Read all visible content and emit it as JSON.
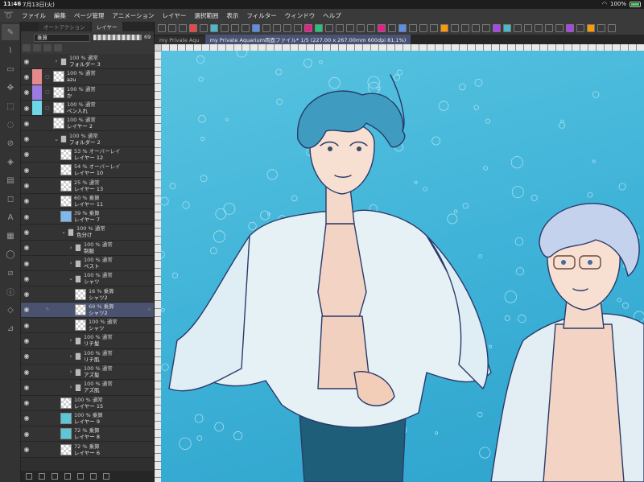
{
  "status": {
    "time": "11:46",
    "date": "7月13日(火)",
    "battery": "100%"
  },
  "menu": [
    "ファイル",
    "編集",
    "ページ管理",
    "アニメーション",
    "レイヤー",
    "選択範囲",
    "表示",
    "フィルター",
    "ウィンドウ",
    "ヘルプ"
  ],
  "panel": {
    "tabs": [
      "オートアクション",
      "レイヤー"
    ],
    "blend_mode": "乗算",
    "opacity": "69"
  },
  "layers": [
    {
      "vis": true,
      "indent": 0,
      "folder": true,
      "arrow": "›",
      "opacity": "100 % 通常",
      "name": "フォルダー 3"
    },
    {
      "vis": true,
      "indent": 0,
      "color": "#e58a8a",
      "opacity": "100 % 通常",
      "name": "azu"
    },
    {
      "vis": true,
      "indent": 0,
      "color": "#9b7be0",
      "opacity": "100 % 通常",
      "name": "か"
    },
    {
      "vis": true,
      "indent": 0,
      "color": "#6fd6e6",
      "opacity": "100 % 通常",
      "name": "ペン入れ"
    },
    {
      "vis": true,
      "indent": 0,
      "thumb": "check",
      "opacity": "100 % 通常",
      "name": "レイヤー 2"
    },
    {
      "vis": true,
      "indent": 0,
      "folder": true,
      "arrow": "⌄",
      "opacity": "100 % 通常",
      "name": "フォルダー 2"
    },
    {
      "vis": true,
      "indent": 1,
      "thumb": "check",
      "opacity": "53 % オーバーレイ",
      "name": "レイヤー 12"
    },
    {
      "vis": true,
      "indent": 1,
      "thumb": "check",
      "opacity": "54 % オーバーレイ",
      "name": "レイヤー 10"
    },
    {
      "vis": true,
      "indent": 1,
      "thumb": "check",
      "opacity": "25 % 通常",
      "name": "レイヤー 13"
    },
    {
      "vis": true,
      "indent": 1,
      "thumb": "check",
      "opacity": "60 % 乗算",
      "name": "レイヤー 11"
    },
    {
      "vis": true,
      "indent": 1,
      "thumb": "blue",
      "opacity": "39 % 乗算",
      "name": "レイヤー 7"
    },
    {
      "vis": true,
      "indent": 1,
      "folder": true,
      "arrow": "⌄",
      "opacity": "100 % 通常",
      "name": "色分け"
    },
    {
      "vis": true,
      "indent": 2,
      "folder": true,
      "arrow": "›",
      "opacity": "100 % 通常",
      "name": "制服"
    },
    {
      "vis": true,
      "indent": 2,
      "folder": true,
      "arrow": "›",
      "opacity": "100 % 通常",
      "name": "ベスト"
    },
    {
      "vis": true,
      "indent": 2,
      "folder": true,
      "arrow": "⌄",
      "opacity": "100 % 通常",
      "name": "シャツ"
    },
    {
      "vis": true,
      "indent": 3,
      "thumb": "check",
      "opacity": "16 % 乗算",
      "name": "シャツ2"
    },
    {
      "vis": true,
      "indent": 3,
      "thumb": "check",
      "opacity": "69 % 乗算",
      "name": "シャツ2",
      "selected": true,
      "pen": true
    },
    {
      "vis": true,
      "indent": 3,
      "thumb": "check",
      "opacity": "100 % 通常",
      "name": "シャツ"
    },
    {
      "vis": true,
      "indent": 2,
      "folder": true,
      "arrow": "›",
      "opacity": "100 % 通常",
      "name": "リチ髪"
    },
    {
      "vis": true,
      "indent": 2,
      "folder": true,
      "arrow": "›",
      "opacity": "100 % 通常",
      "name": "リチ肌"
    },
    {
      "vis": true,
      "indent": 2,
      "folder": true,
      "arrow": "›",
      "opacity": "100 % 通常",
      "name": "アズ髪"
    },
    {
      "vis": true,
      "indent": 2,
      "folder": true,
      "arrow": "›",
      "opacity": "100 % 通常",
      "name": "アズ肌"
    },
    {
      "vis": true,
      "indent": 1,
      "thumb": "check",
      "opacity": "100 % 通常",
      "name": "レイヤー 15"
    },
    {
      "vis": true,
      "indent": 1,
      "thumb": "teal",
      "opacity": "100 % 乗算",
      "name": "レイヤー 9"
    },
    {
      "vis": true,
      "indent": 1,
      "thumb": "teal",
      "opacity": "72 % 乗算",
      "name": "レイヤー 8"
    },
    {
      "vis": true,
      "indent": 1,
      "thumb": "check",
      "opacity": "72 % 乗算",
      "name": "レイヤー 6"
    }
  ],
  "doc_tabs": [
    {
      "label": "my Private Aqu",
      "active": false
    },
    {
      "label": "my Private Aquarium両面ファイル* 1/5 (227.00 x 267.00mm 600dpi 81.1%)",
      "active": true
    }
  ],
  "toolbar_colors": [
    "#e91e8c",
    "#27c27b",
    "#5a8dee",
    "#e44",
    "#a4e",
    "#4bc",
    "#f90"
  ],
  "canvas": {
    "bg_top": "#58c3e0",
    "bg_bottom": "#2ea3cc"
  }
}
